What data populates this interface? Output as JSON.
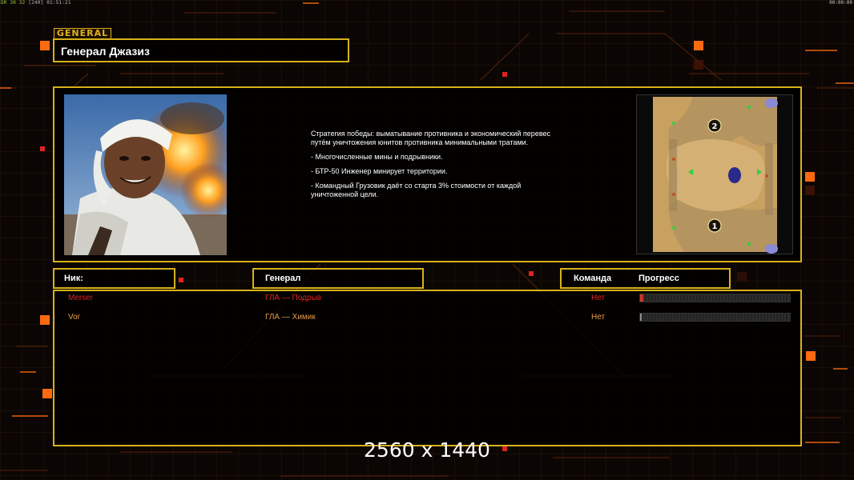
{
  "hud": {
    "top_left_prefix": "DR",
    "top_left_stats": "30 32",
    "top_left_fps": "[240]",
    "top_left_time": "01:51:21",
    "top_right_time": "00:00:00"
  },
  "general_tag": "GENERAL",
  "title": "Генерал Джазиз",
  "description": [
    "Стратегия победы: выматывание противника и экономический перевес путём уничтожения юнитов противника минимальными тратами.",
    "- Многочисленные мины и подрывники.",
    "- БТР-50 Инженер минирует территории.",
    "- Командный Грузовик даёт со старта 3% стоимости от каждой уничтоженной цели."
  ],
  "minimap": {
    "start_positions": [
      "1",
      "2"
    ]
  },
  "columns": {
    "nick": "Ник:",
    "general": "Генерал",
    "team": "Команда",
    "progress": "Прогресс"
  },
  "players": [
    {
      "nick": "Merser",
      "general": "ГЛА — Подрыв",
      "team": "Нет",
      "progress": 0.02,
      "color": "#e0231f"
    },
    {
      "nick": "Vor",
      "general": "ГЛА — Химик",
      "team": "Нет",
      "progress": 0.01,
      "color": "#e89a4a"
    }
  ],
  "watermark": "2560 x 1440",
  "colors": {
    "frame": "#d8b21a",
    "accent_orange": "#ff6a10",
    "player1": "#e0231f",
    "player2": "#e89a4a"
  }
}
